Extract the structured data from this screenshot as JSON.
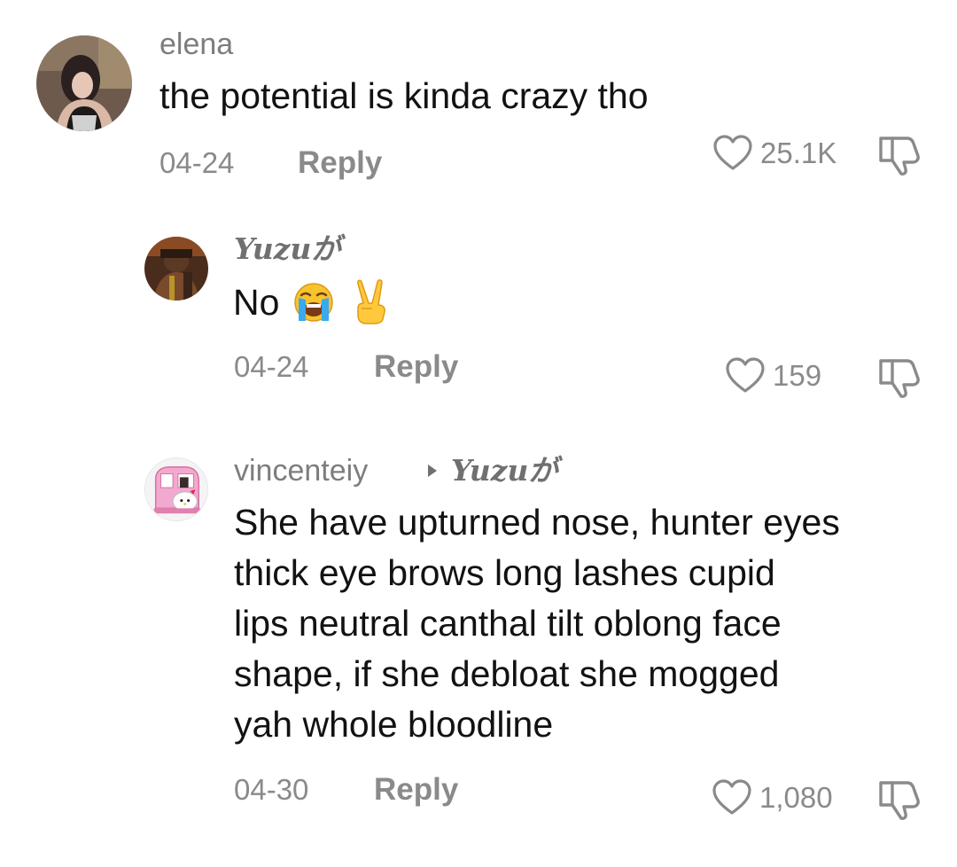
{
  "comments": [
    {
      "username": "elena",
      "text": "the potential is kinda crazy tho",
      "date": "04-24",
      "reply_label": "Reply",
      "likes": "25.1K",
      "avatar": "profile-photo"
    },
    {
      "username": "Yuzuが",
      "text": "No",
      "emojis": [
        "loudly-crying-face",
        "victory-hand"
      ],
      "date": "04-24",
      "reply_label": "Reply",
      "likes": "159",
      "avatar": "profile-photo"
    },
    {
      "username": "vincenteiy",
      "reply_to": "Yuzuが",
      "text_lines": [
        "She have upturned nose, hunter eyes",
        "thick eye brows long lashes cupid",
        "lips neutral canthal tilt oblong face",
        "shape, if she debloat she mogged",
        "yah whole bloodline"
      ],
      "date": "04-30",
      "reply_label": "Reply",
      "likes": "1,080",
      "avatar": "hello-kitty-car"
    }
  ],
  "icons": {
    "like": "heart-outline-icon",
    "dislike": "thumbs-down-outline-icon",
    "reply_to_arrow": "triangle-right-icon"
  },
  "colors": {
    "text": "#121212",
    "muted": "#8a8a8a",
    "username": "#7d7d7d"
  }
}
